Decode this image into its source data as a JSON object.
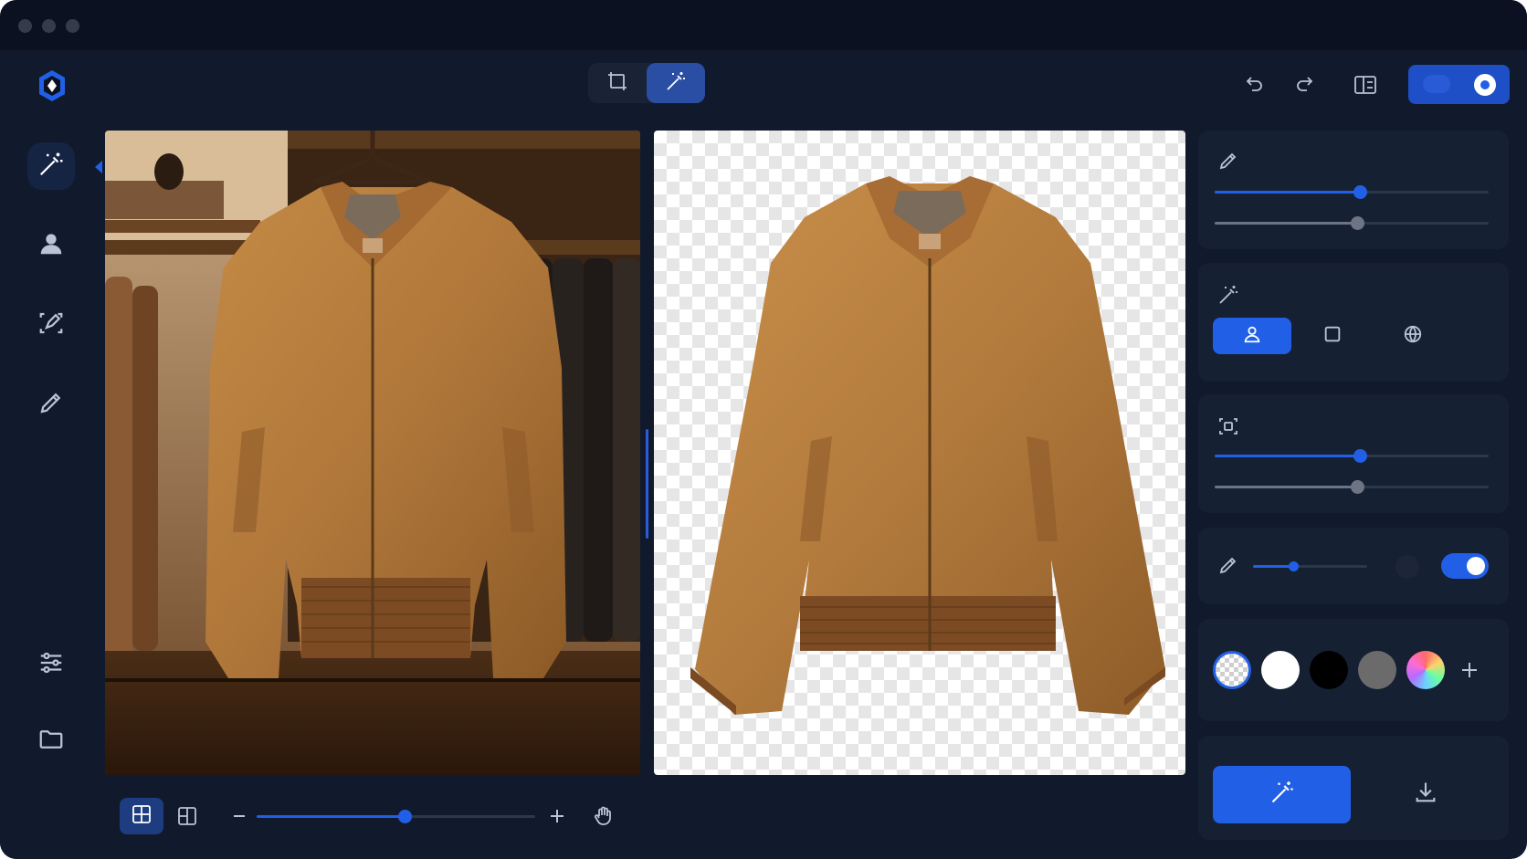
{
  "window": {
    "controls": [
      "close",
      "minimize",
      "zoom"
    ]
  },
  "header": {
    "logo_icon": "hexagon-logo-icon",
    "modes": [
      {
        "icon": "crop-frame-icon",
        "active": false
      },
      {
        "icon": "magic-wand-icon",
        "active": true
      }
    ],
    "actions": [
      "undo-icon",
      "redo-icon",
      "compare-layout-icon"
    ],
    "theme_toggle": {
      "state": "on"
    }
  },
  "sidebar": {
    "top_items": [
      {
        "icon": "magic-wand-icon",
        "active": true
      },
      {
        "icon": "person-icon",
        "active": false
      },
      {
        "icon": "selection-edit-icon",
        "active": false
      },
      {
        "icon": "brush-icon",
        "active": false
      }
    ],
    "bottom_items": [
      {
        "icon": "adjustments-icon"
      },
      {
        "icon": "folder-icon"
      }
    ]
  },
  "canvas": {
    "left_image": "original-jacket-photo",
    "right_image": "jacket-cutout-transparent"
  },
  "panels": {
    "brush": {
      "slider1": 0.53,
      "slider2": 0.52
    },
    "detect": {
      "modes": [
        "person-icon",
        "square-icon",
        "globe-icon"
      ],
      "active_mode": 0
    },
    "selection": {
      "slider1": 0.53,
      "slider2": 0.52
    },
    "refine": {
      "slider": 0.35,
      "toggle": true
    },
    "background": {
      "swatches": [
        "transparent",
        "#ffffff",
        "#000000",
        "#6b6b6b",
        "rainbow"
      ],
      "selected": 0
    }
  },
  "bottom_bar": {
    "view_modes": [
      "grid-view-icon",
      "split-view-icon"
    ],
    "active_view": 0,
    "zoom": 0.53
  },
  "actions": {
    "apply": "magic-wand-icon",
    "download": "download-icon"
  },
  "colors": {
    "accent": "#2160e6",
    "bg": "#111a2c",
    "panel": "#162033"
  }
}
